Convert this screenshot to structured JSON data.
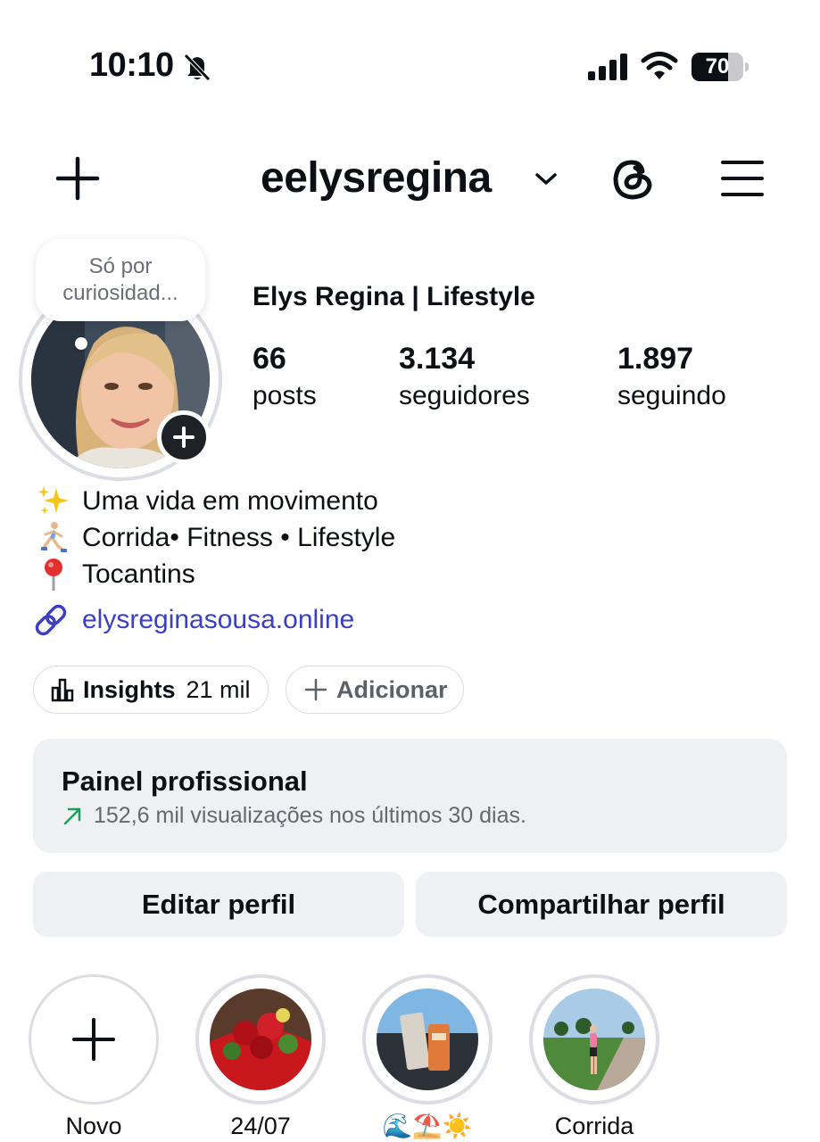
{
  "status_bar": {
    "time": "10:10",
    "battery": "70",
    "battery_level": 0.7
  },
  "header": {
    "username": "eelysregina"
  },
  "profile": {
    "note": "Só por curiosidad...",
    "display_name": "Elys Regina | Lifestyle",
    "stats": [
      {
        "value": "66",
        "label": "posts"
      },
      {
        "value": "3.134",
        "label": "seguidores"
      },
      {
        "value": "1.897",
        "label": "seguindo"
      }
    ],
    "bio": [
      {
        "icon": "sparkles",
        "text": "Uma vida em movimento"
      },
      {
        "icon": "runner",
        "text": "Corrida• Fitness • Lifestyle"
      },
      {
        "icon": "pin",
        "text": "Tocantins"
      }
    ],
    "link": "elysreginasousa.online"
  },
  "chips": {
    "insights_label": "Insights",
    "insights_count": "21 mil",
    "add_label": "Adicionar"
  },
  "dashboard": {
    "title": "Painel profissional",
    "subtitle": "152,6 mil visualizações nos últimos 30 dias."
  },
  "buttons": {
    "edit": "Editar perfil",
    "share": "Compartilhar perfil"
  },
  "highlights": [
    {
      "label": "Novo"
    },
    {
      "label": "24/07"
    },
    {
      "label": "🌊⛱️☀️"
    },
    {
      "label": "Corrida"
    }
  ],
  "colors": {
    "link": "#3a3fc4",
    "trend_arrow": "#1f9e5a",
    "surface": "#eff0f3",
    "ring": "#dbdde2"
  }
}
